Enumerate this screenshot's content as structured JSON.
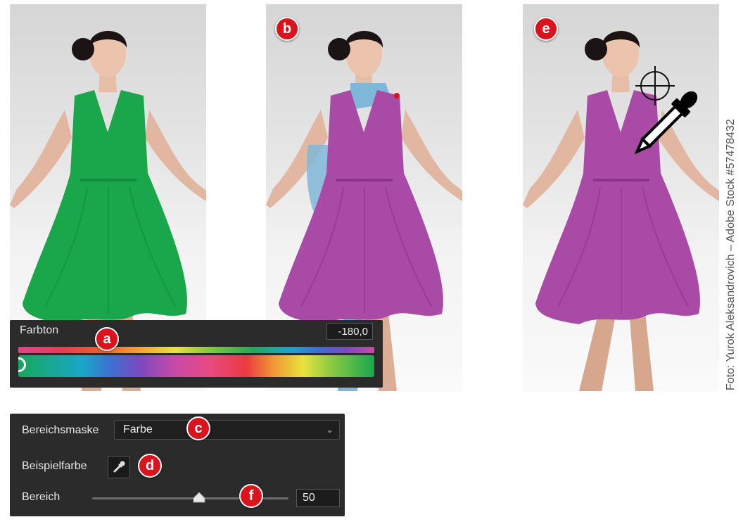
{
  "badges": {
    "a": "a",
    "b": "b",
    "c": "c",
    "d": "d",
    "e": "e",
    "f": "f"
  },
  "credit": "Foto: Yurok Aleksandrovich – Adobe Stock #57478432",
  "hue_panel": {
    "label": "Farbton",
    "value": "-180,0"
  },
  "mask_panel": {
    "mask_label": "Bereichsmaske",
    "mask_selected": "Farbe",
    "sample_label": "Beispielfarbe",
    "range_label": "Bereich",
    "range_value": "50",
    "range_fraction": 0.5
  },
  "colors": {
    "dress_original": "#1aa64a",
    "dress_shifted": "#a84aa6",
    "mask_overlay": "#7fb7d8",
    "badge": "#d9141c",
    "panel_bg": "#2b2b2b"
  },
  "icons": {
    "eyedropper": "eyedropper-icon",
    "crosshair": "crosshair-icon",
    "dropdown": "chevron-down-icon",
    "slider_thumb": "slider-thumb-icon"
  }
}
